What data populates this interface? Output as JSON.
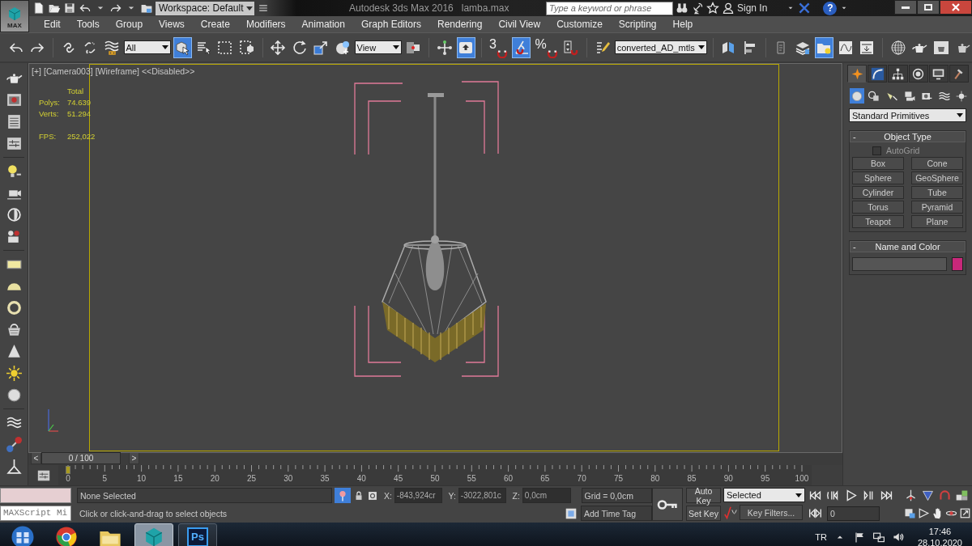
{
  "title_bar": {
    "logo_text": "MAX",
    "workspace": "Workspace: Default",
    "app_title": "Autodesk 3ds Max 2016",
    "file_name": "lamba.max",
    "search": {
      "placeholder": "Type a keyword or phrase"
    },
    "sign_in": "Sign In",
    "help": "?"
  },
  "menu": [
    "Edit",
    "Tools",
    "Group",
    "Views",
    "Create",
    "Modifiers",
    "Animation",
    "Graph Editors",
    "Rendering",
    "Civil View",
    "Customize",
    "Scripting",
    "Help"
  ],
  "toolbar": [
    {
      "kind": "button",
      "selected": false
    },
    {
      "kind": "button",
      "selected": false
    },
    {
      "kind": "sep"
    },
    {
      "kind": "button",
      "selected": false
    },
    {
      "kind": "button",
      "selected": false
    },
    {
      "kind": "button",
      "selected": false
    },
    {
      "kind": "dropdown",
      "value": "All"
    },
    {
      "kind": "button",
      "selected": true
    },
    {
      "kind": "button",
      "selected": false
    },
    {
      "kind": "button",
      "selected": false
    },
    {
      "kind": "button",
      "selected": false
    },
    {
      "kind": "sep"
    },
    {
      "kind": "button",
      "selected": false
    },
    {
      "kind": "button",
      "selected": false
    },
    {
      "kind": "button",
      "selected": false
    },
    {
      "kind": "button",
      "selected": false
    },
    {
      "kind": "dropdown",
      "value": "View"
    },
    {
      "kind": "button",
      "selected": false
    },
    {
      "kind": "sep"
    },
    {
      "kind": "button",
      "selected": false
    },
    {
      "kind": "button",
      "selected": true
    },
    {
      "kind": "sep"
    },
    {
      "kind": "snap",
      "label": "3",
      "selected": false
    },
    {
      "kind": "button",
      "selected": true
    },
    {
      "kind": "snap",
      "label": "%",
      "selected": false
    },
    {
      "kind": "button",
      "selected": false
    },
    {
      "kind": "sep"
    },
    {
      "kind": "button",
      "selected": false
    },
    {
      "kind": "dropdown",
      "value": "converted_AD_mtls"
    },
    {
      "kind": "sep"
    },
    {
      "kind": "button",
      "selected": false
    },
    {
      "kind": "button",
      "selected": false
    },
    {
      "kind": "sep"
    },
    {
      "kind": "button",
      "selected": false
    },
    {
      "kind": "button",
      "selected": false
    },
    {
      "kind": "button",
      "selected": true
    },
    {
      "kind": "button",
      "selected": false
    },
    {
      "kind": "button",
      "selected": false
    },
    {
      "kind": "sep"
    },
    {
      "kind": "button",
      "selected": false
    },
    {
      "kind": "button",
      "selected": false
    },
    {
      "kind": "button",
      "selected": false
    },
    {
      "kind": "button",
      "selected": false
    }
  ],
  "viewport": {
    "labels": [
      "[+]",
      "[Camera003]",
      "[Wireframe]",
      "<<Disabled>>"
    ],
    "stats": {
      "heading": "Total",
      "rows": [
        {
          "label": "Polys:",
          "value": "74.639"
        },
        {
          "label": "Verts:",
          "value": "51.294"
        }
      ],
      "fps": {
        "label": "FPS:",
        "value": "252,022"
      }
    }
  },
  "command_panel": {
    "tabs": [
      {
        "selected": true
      },
      {
        "selected": false
      },
      {
        "selected": false
      },
      {
        "selected": false
      },
      {
        "selected": false
      },
      {
        "selected": false
      }
    ],
    "categories": [
      {
        "selected": true
      },
      {
        "selected": false
      },
      {
        "selected": false
      },
      {
        "selected": false
      },
      {
        "selected": false
      },
      {
        "selected": false
      },
      {
        "selected": false
      }
    ],
    "dropdown": "Standard Primitives",
    "rollouts": [
      {
        "kind": "object_type",
        "collapse": "-",
        "title": "Object Type",
        "checkbox": {
          "label": "AutoGrid",
          "checked": false
        },
        "buttons": [
          "Box",
          "Cone",
          "Sphere",
          "GeoSphere",
          "Cylinder",
          "Tube",
          "Torus",
          "Pyramid",
          "Teapot",
          "Plane"
        ]
      },
      {
        "kind": "name_color",
        "collapse": "-",
        "title": "Name and Color",
        "color": "#c8287a"
      }
    ]
  },
  "timeline": {
    "prev": "<",
    "next": ">",
    "position": "0 / 100",
    "level": 0,
    "frames": [
      "0",
      "5",
      "10",
      "15",
      "20",
      "25",
      "30",
      "35",
      "40",
      "45",
      "50",
      "55",
      "60",
      "65",
      "70",
      "75",
      "80",
      "85",
      "90",
      "95",
      "100"
    ]
  },
  "status": {
    "listener": "MAXScript Mi",
    "selection": "None Selected",
    "prompt": "Click or click-and-drag to select objects",
    "isolate_on": true,
    "coords": [
      {
        "axis": "X:",
        "value": "-843,924cr"
      },
      {
        "axis": "Y:",
        "value": "-3022,801c"
      },
      {
        "axis": "Z:",
        "value": "0,0cm"
      }
    ],
    "grid": "Grid = 0,0cm",
    "time_tag": "Add Time Tag",
    "auto_key": "Auto Key",
    "set_key": "Set Key",
    "key_set": "Selected",
    "key_filters": "Key Filters...",
    "frame": "0"
  },
  "taskbar": {
    "apps": [
      {
        "running": false,
        "selected": false
      },
      {
        "running": false,
        "selected": false
      },
      {
        "running": true,
        "selected": true
      },
      {
        "running": true,
        "selected": false,
        "label": "Ps"
      }
    ],
    "language": "TR",
    "time": "17:46",
    "date": "28.10.2020"
  }
}
